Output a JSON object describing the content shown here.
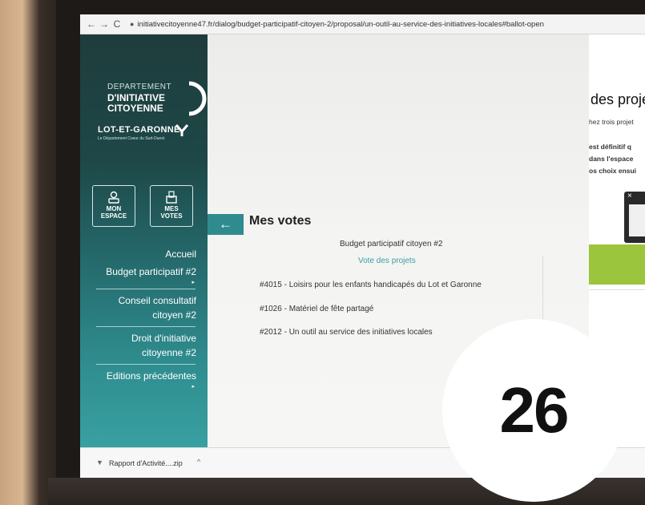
{
  "browser": {
    "back": "←",
    "forward": "→",
    "reload": "C",
    "url": "initiativecitoyenne47.fr/dialog/budget-participatif-citoyen-2/proposal/un-outil-au-service-des-initiatives-locales#ballot-open"
  },
  "sidebar": {
    "dept_line1": "DEPARTEMENT",
    "dept_line2": "D'INITIATIVE",
    "dept_line3": "CITOYENNE",
    "lot_garonne": "LOT-ET-GARONNE",
    "lot_garonne_sub": "Le Département Coeur du Sud-Ouest",
    "mon_espace": [
      "MON",
      "ESPACE"
    ],
    "mes_votes": [
      "MES",
      "VOTES"
    ],
    "menu": [
      {
        "label": "Accueil"
      },
      {
        "label": "Budget participatif #2"
      },
      {
        "label_a": "Conseil consultatif",
        "label_b": "citoyen #2"
      },
      {
        "label_a": "Droit d'initiative",
        "label_b": "citoyenne #2"
      },
      {
        "label": "Editions précédentes"
      }
    ],
    "caret": "▸"
  },
  "main": {
    "back_arrow": "←",
    "title": "Mes votes",
    "budget_title": "Budget participatif citoyen #2",
    "vote_link": "Vote des projets",
    "projects": [
      "#4015 - Loisirs pour les enfants handicapés du Lot et Garonne",
      "#1026 - Matériel de fête partagé",
      "#2012 - Un outil au service des initiatives locales"
    ]
  },
  "right_panel": {
    "title": "des proje",
    "line1": "hez trois projet",
    "line2": "est définitif q",
    "line3": "dans l'espace",
    "line4": "os choix ensui",
    "close": "×"
  },
  "download": {
    "file": "Rapport d'Activité....zip",
    "caret": "^"
  },
  "badge": {
    "number": "26"
  },
  "colors": {
    "accent": "#2f8b8e",
    "link": "#3a9ea0",
    "green": "#9bc53d"
  }
}
